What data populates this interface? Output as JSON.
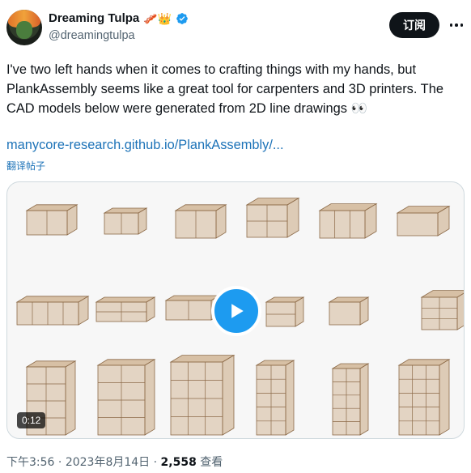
{
  "author": {
    "display_name": "Dreaming Tulpa",
    "emojis": "🥓👑",
    "handle": "@dreamingtulpa"
  },
  "header": {
    "follow_label": "订阅"
  },
  "tweet": {
    "text": "I've two left hands when it comes to crafting things with my hands, but PlankAssembly seems like a great tool for carpenters and 3D printers. The CAD models below were generated from 2D line drawings 👀",
    "link": "manycore-research.github.io/PlankAssembly/...",
    "translate_label": "翻译帖子"
  },
  "media": {
    "duration": "0:12",
    "wood_color": "#c9a882",
    "wood_edge": "#8c6a48"
  },
  "meta": {
    "time": "下午3:56",
    "sep1": " · ",
    "date": "2023年8月14日",
    "sep2": " · ",
    "views": "2,558",
    "views_label": " 查看"
  },
  "colors": {
    "link": "#1d73b8",
    "play": "#1d9bf0",
    "verified": "#1d9bf0"
  }
}
